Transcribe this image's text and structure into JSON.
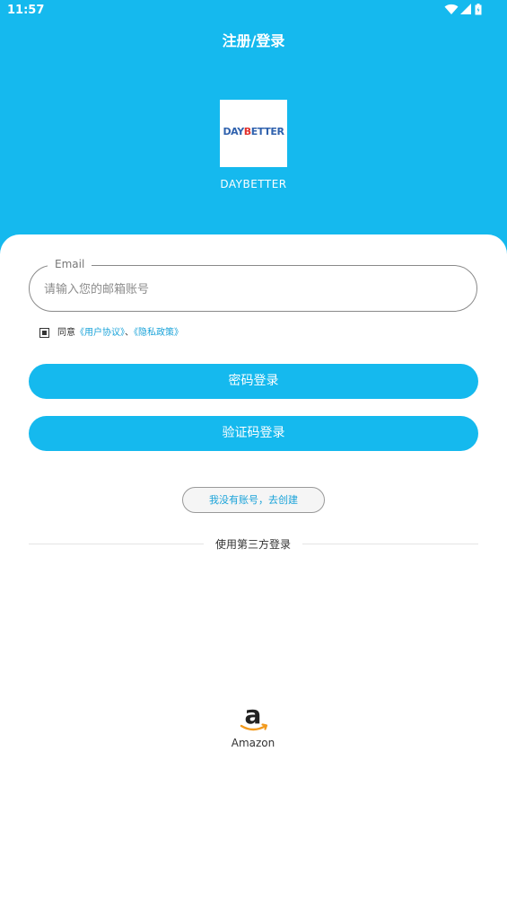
{
  "status_bar": {
    "time": "11:57",
    "icons": [
      "wifi-icon",
      "signal-icon",
      "battery-icon"
    ]
  },
  "header": {
    "title": "注册/登录",
    "logo_text_1": "DAY",
    "logo_text_2": "B",
    "logo_text_3": "ETTER",
    "brand_name": "DAYBETTER"
  },
  "form": {
    "email_label": "Email",
    "email_placeholder": "请输入您的邮箱账号",
    "email_value": "",
    "agree_prefix": "同意",
    "user_agreement": "《用户协议》",
    "separator": "、",
    "privacy_policy": "《隐私政策》"
  },
  "buttons": {
    "password_login": "密码登录",
    "code_login": "验证码登录",
    "create_account": "我没有账号，去创建"
  },
  "third_party": {
    "title": "使用第三方登录",
    "amazon_label": "Amazon"
  },
  "colors": {
    "primary": "#15b9ee",
    "link": "#1aa3d9",
    "amazon_orange": "#f29a1d"
  }
}
